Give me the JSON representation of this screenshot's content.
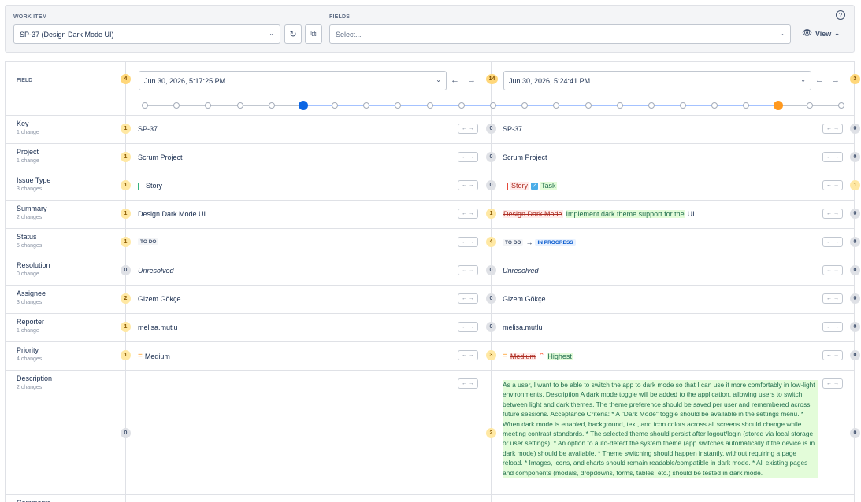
{
  "filters": {
    "work_item_label": "WORK ITEM",
    "work_item_value": "SP-37 (Design Dark Mode UI)",
    "fields_label": "FIELDS",
    "fields_placeholder": "Select...",
    "view_label": "View",
    "help_symbol": "?"
  },
  "history": {
    "field_header": "FIELD",
    "left": {
      "date": "Jun 30, 2026, 5:17:25 PM",
      "badge_before": "4",
      "version_index": 5
    },
    "right": {
      "date": "Jun 30, 2026, 5:24:41 PM",
      "badge_before": "14",
      "badge_after": "3",
      "version_index": 20
    },
    "timeline_points": 23,
    "rows": [
      {
        "name": "Key",
        "changes": "1 change",
        "lb": "1",
        "lv": "SP-37",
        "rb": "0",
        "rv": "SP-37",
        "eb": "0"
      },
      {
        "name": "Project",
        "changes": "1 change",
        "lb": "1",
        "lv": "Scrum Project",
        "rb": "0",
        "rv": "Scrum Project",
        "eb": "0"
      },
      {
        "name": "Issue Type",
        "changes": "3 changes",
        "lb": "1",
        "lv": "Story",
        "rb": "0",
        "rv_del": "Story",
        "rv_ins": "Task",
        "eb": "1"
      },
      {
        "name": "Summary",
        "changes": "2 changes",
        "lb": "1",
        "lv": "Design Dark Mode UI",
        "rb": "1",
        "rv_del": "Design Dark Mode",
        "rv_ins": "Implement dark theme support for the",
        "rv_rest": "UI",
        "eb": "0"
      },
      {
        "name": "Status",
        "changes": "5 changes",
        "lb": "1",
        "lv": "TO DO",
        "rb": "4",
        "rv_from": "TO DO",
        "rv_to": "IN PROGRESS",
        "eb": "0"
      },
      {
        "name": "Resolution",
        "changes": "0 change",
        "lb": "0",
        "lv": "Unresolved",
        "rb": "0",
        "rv": "Unresolved",
        "eb": "0"
      },
      {
        "name": "Assignee",
        "changes": "3 changes",
        "lb": "2",
        "lv": "Gizem Gökçe",
        "rb": "0",
        "rv": "Gizem Gökçe",
        "eb": "0"
      },
      {
        "name": "Reporter",
        "changes": "1 change",
        "lb": "1",
        "lv": "melisa.mutlu",
        "rb": "0",
        "rv": "melisa.mutlu",
        "eb": "0"
      },
      {
        "name": "Priority",
        "changes": "4 changes",
        "lb": "1",
        "lv": "Medium",
        "rb": "3",
        "rv_del": "Medium",
        "rv_ins": "Highest",
        "eb": "0"
      },
      {
        "name": "Description",
        "changes": "2 changes",
        "lb": "0",
        "rb": "2",
        "eb": "0",
        "rv_ins": "As a user, I want to be able to switch the app to dark mode so that I can use it more comfortably in low-light environments. Description A dark mode toggle will be added to the application, allowing users to switch between light and dark themes. The theme preference should be saved per user and remembered across future sessions. Acceptance Criteria: * A \"Dark Mode\" toggle should be available in the settings menu. * When dark mode is enabled, background, text, and icon colors across all screens should change while meeting contrast standards. * The selected theme should persist after logout/login (stored via local storage or user settings). * An option to auto-detect the system theme (app switches automatically if the device is in dark mode) should be available. * Theme switching should happen instantly, without requiring a page reload. * Images, icons, and charts should remain readable/compatible in dark mode. * All existing pages and components (modals, dropdowns, forms, tables, etc.) should be tested in dark mode."
      },
      {
        "name": "Comments"
      }
    ],
    "nav_symbols": {
      "prev": "←",
      "next": "→",
      "mini": "← →",
      "to": "→"
    }
  },
  "colors": {
    "accent": "#0c66e4",
    "compare": "#ff991f",
    "added_bg": "#e3fcd9",
    "removed_text": "#ae2e24"
  }
}
